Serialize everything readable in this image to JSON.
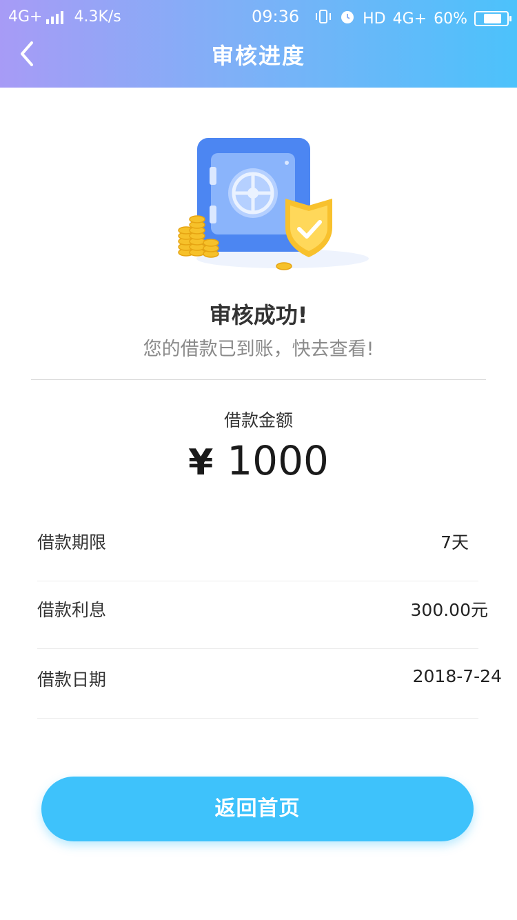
{
  "status_bar": {
    "network_left": "4G+",
    "speed": "4.3K/s",
    "time": "09:36",
    "hd": "HD",
    "network_right": "4G+",
    "battery": "60%",
    "battery_level": 0.6
  },
  "header": {
    "title": "审核进度"
  },
  "result": {
    "title": "审核成功!",
    "subtitle": "您的借款已到账，快去查看!"
  },
  "amount": {
    "label": "借款金额",
    "currency": "¥",
    "value": "1000"
  },
  "details": [
    {
      "label": "借款期限",
      "value": "7天"
    },
    {
      "label": "借款利息",
      "value": "300.00元"
    },
    {
      "label": "借款日期",
      "value": "2018-7-24"
    }
  ],
  "actions": {
    "home_label": "返回首页"
  },
  "colors": {
    "accent": "#3ec2fb",
    "header_start": "#a79bf6",
    "header_end": "#4cc2fb"
  }
}
